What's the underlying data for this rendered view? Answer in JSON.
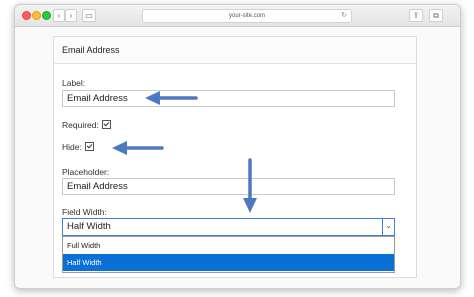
{
  "browser": {
    "url": "your-site.com",
    "nav": {
      "back": "‹",
      "forward": "›",
      "sidebar": "▭"
    },
    "reload": "↻",
    "share": "⇪",
    "tabs": "⧉"
  },
  "form": {
    "title": "Email Address",
    "label_field": {
      "label": "Label:",
      "value": "Email Address"
    },
    "required": {
      "label": "Required:",
      "checked": true
    },
    "hide": {
      "label": "Hide:",
      "checked": true
    },
    "placeholder_field": {
      "label": "Placeholder:",
      "value": "Email Address"
    },
    "field_width": {
      "label": "Field Width:",
      "selected": "Half Width",
      "options": [
        "Full Width",
        "Half Width"
      ]
    }
  },
  "annotation": {
    "arrow_color": "#4e79c0",
    "icon": "arrow-icon"
  },
  "colors": {
    "highlight": "#0a6fd6",
    "focus_border": "#3d7fd9"
  }
}
